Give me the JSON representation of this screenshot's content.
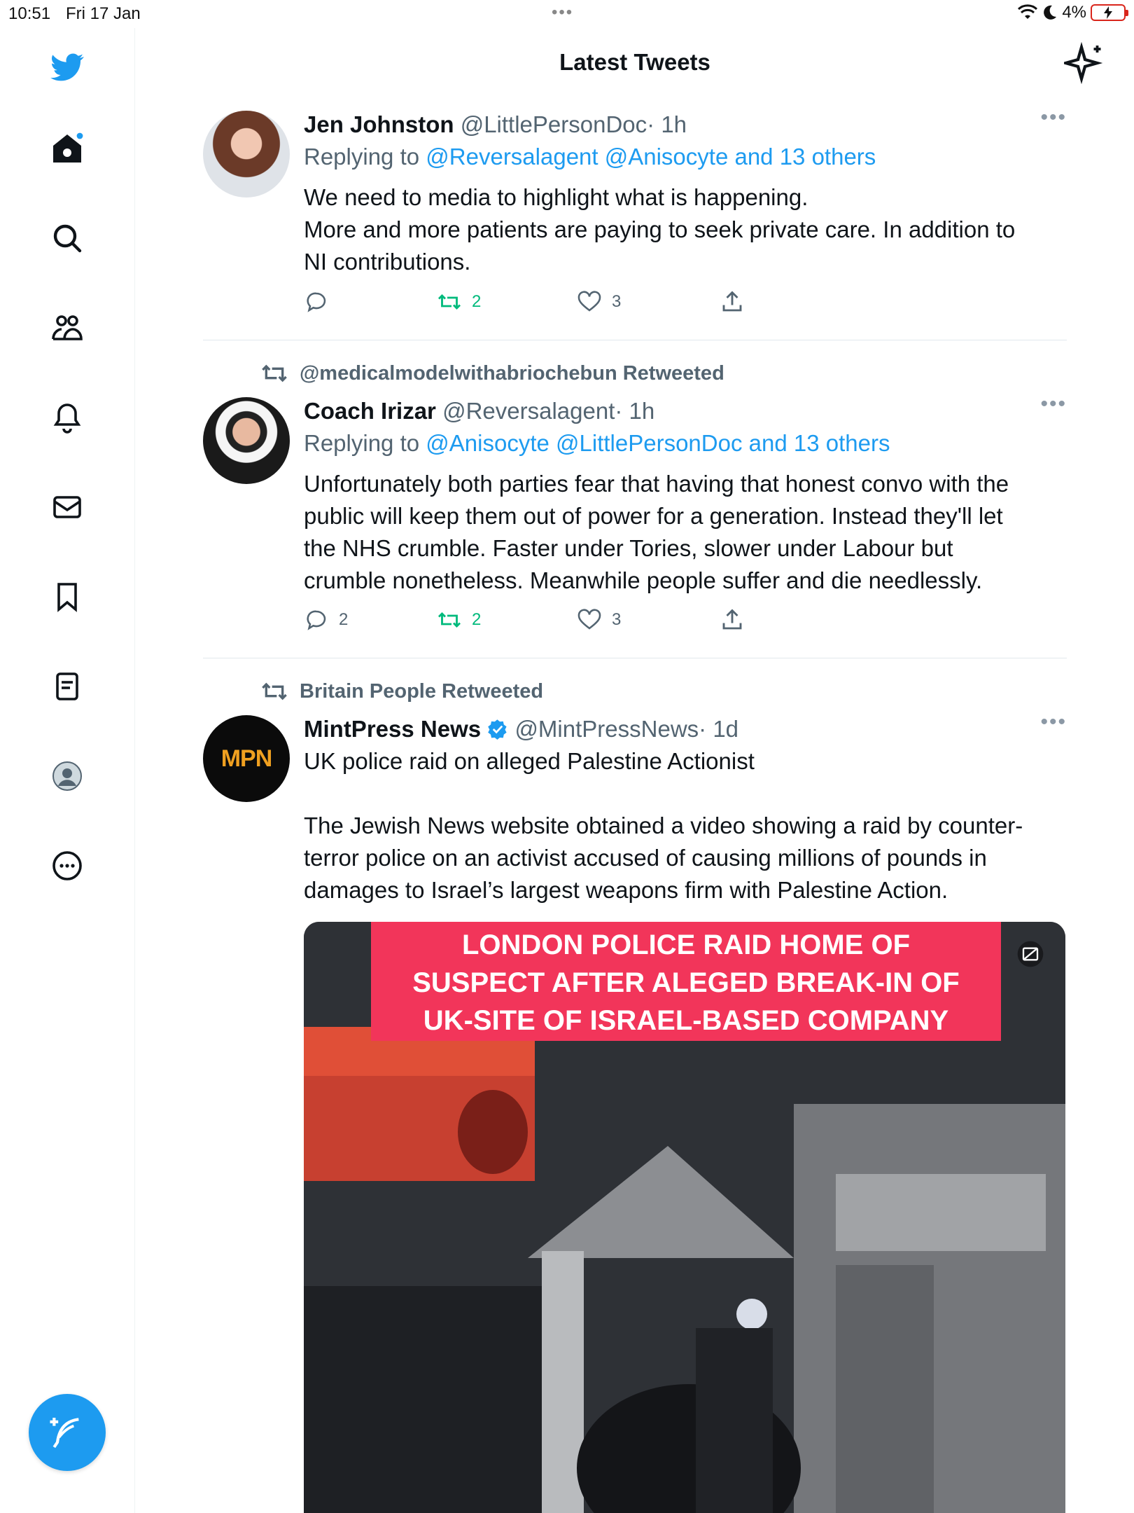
{
  "status_bar": {
    "time": "10:51",
    "date": "Fri 17 Jan",
    "battery": "4%"
  },
  "header": {
    "title": "Latest Tweets"
  },
  "sidebar": {
    "items": [
      "twitter-logo",
      "home",
      "search",
      "communities",
      "notifications",
      "messages",
      "bookmarks",
      "lists",
      "profile",
      "more"
    ]
  },
  "tweets": [
    {
      "name": "Jen Johnston",
      "handle": "@LittlePersonDoc",
      "time": "· 1h",
      "replying_prefix": "Replying to",
      "replying_to": "@Reversalagent @Anisocyte and 13 others",
      "text_lines": [
        "We need to media to highlight what is happening.",
        "More and more patients are paying to seek private care. In addition to",
        "NI contributions."
      ],
      "replies": "",
      "retweets": "2",
      "likes": "3"
    },
    {
      "retweeted_by": "@medicalmodelwithabriochebun Retweeted",
      "name": "Coach Irizar",
      "handle": "@Reversalagent",
      "time": "· 1h",
      "replying_prefix": "Replying to",
      "replying_to": "@Anisocyte @LittlePersonDoc and 13 others",
      "text_lines": [
        "Unfortunately both parties fear that having that honest convo with the",
        "public will keep them out of power for a generation. Instead they'll let",
        "the NHS crumble. Faster under Tories, slower under Labour but",
        "crumble nonetheless. Meanwhile people suffer and die needlessly."
      ],
      "replies": "2",
      "retweets": "2",
      "likes": "3"
    },
    {
      "retweeted_by": "Britain People Retweeted",
      "name": "MintPress News",
      "handle": "@MintPressNews",
      "time": "· 1d",
      "avatar_text": "MPN",
      "headline": "UK police raid on alleged Palestine Actionist",
      "text_lines": [
        "The Jewish News website obtained a video showing a raid by counter-",
        "terror police on an activist accused of causing millions of pounds in",
        "damages to Israel’s largest weapons firm with Palestine Action."
      ],
      "media_banner": [
        "LONDON POLICE RAID HOME OF",
        "SUSPECT AFTER ALEGED BREAK-IN OF",
        "UK-SITE OF ISRAEL-BASED COMPANY"
      ]
    }
  ],
  "colors": {
    "accent": "#1d9bf0",
    "retweet": "#00ba7c",
    "muted": "#536471",
    "banner": "#f2355a"
  }
}
